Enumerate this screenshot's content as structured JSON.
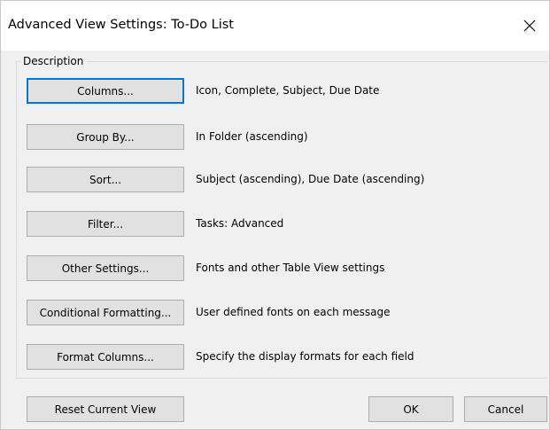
{
  "dialog": {
    "title": "Advanced View Settings: To-Do List",
    "group_label": "Description",
    "rows": [
      {
        "button": "Columns...",
        "description": "Icon, Complete, Subject, Due Date"
      },
      {
        "button": "Group By...",
        "description": "In Folder (ascending)"
      },
      {
        "button": "Sort...",
        "description": "Subject (ascending), Due Date (ascending)"
      },
      {
        "button": "Filter...",
        "description": "Tasks: Advanced"
      },
      {
        "button": "Other Settings...",
        "description": "Fonts and other Table View settings"
      },
      {
        "button": "Conditional Formatting...",
        "description": "User defined fonts on each message"
      },
      {
        "button": "Format Columns...",
        "description": "Specify the display formats for each field"
      }
    ],
    "footer": {
      "reset_label": "Reset Current View",
      "ok_label": "OK",
      "cancel_label": "Cancel"
    },
    "icons": {
      "close": "close-icon"
    },
    "colors": {
      "focus_border": "#0078d7",
      "button_face": "#e1e1e1",
      "dialog_bg": "#f0f0f0"
    }
  }
}
